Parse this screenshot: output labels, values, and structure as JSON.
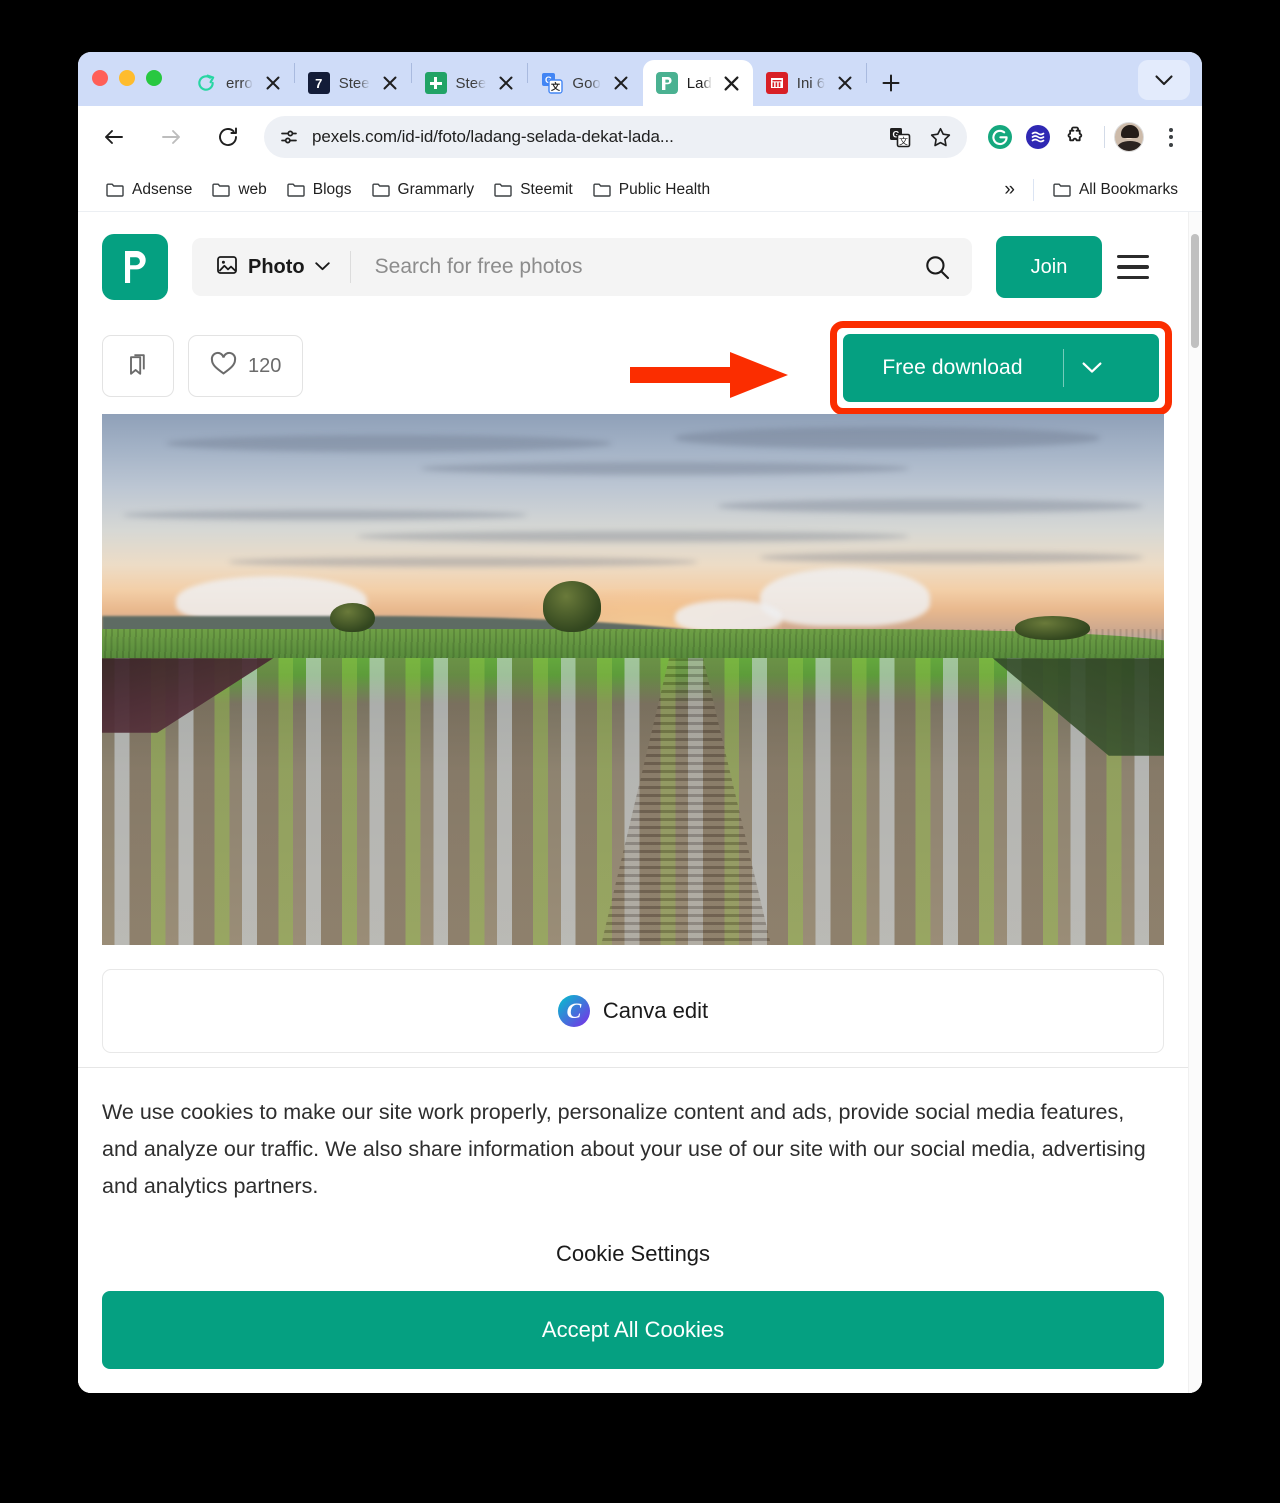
{
  "browser": {
    "tabs": [
      {
        "title": "erro",
        "favicon": "error-spiral-icon",
        "active": false
      },
      {
        "title": "Stee",
        "favicon": "seven-icon",
        "active": false
      },
      {
        "title": "Stee",
        "favicon": "sheets-icon",
        "active": false
      },
      {
        "title": "Goo",
        "favicon": "google-translate-icon",
        "active": false
      },
      {
        "title": "Lad",
        "favicon": "pexels-icon",
        "active": true
      },
      {
        "title": "Ini 6",
        "favicon": "ini-icon",
        "active": false
      }
    ],
    "new_tab_label": "+",
    "tab_list_chevron": "chevron-down-icon",
    "omnibox": {
      "url": "pexels.com/id-id/foto/ladang-selada-dekat-lada...",
      "site_info_icon": "tune-icon",
      "translate_icon": "translate-icon",
      "bookmark_icon": "star-icon"
    },
    "toolbar_extensions": [
      "grammarly-icon",
      "steem-icon",
      "extensions-puzzle-icon"
    ],
    "profile": "profile-avatar",
    "menu": "three-dots-menu-icon",
    "bookmarks": [
      {
        "label": "Adsense"
      },
      {
        "label": "web"
      },
      {
        "label": "Blogs"
      },
      {
        "label": "Grammarly"
      },
      {
        "label": "Steemit"
      },
      {
        "label": "Public Health"
      }
    ],
    "bookmarks_overflow": "»",
    "all_bookmarks_label": "All Bookmarks"
  },
  "pexels": {
    "logo": "pexels-logo",
    "search": {
      "type_label": "Photo",
      "type_icon": "image-icon",
      "chevron": "chevron-down-icon",
      "placeholder": "Search for free photos",
      "search_icon": "search-icon"
    },
    "join_label": "Join",
    "menu_icon": "hamburger-menu-icon",
    "actions": {
      "bookmark_icon": "collection-bookmark-icon",
      "like_icon": "heart-icon",
      "like_count": "120",
      "download_label": "Free download",
      "download_caret": "chevron-down-icon"
    },
    "annotation": {
      "arrow": "red-arrow-right",
      "highlight_color": "#fb2d00"
    },
    "photo": {
      "alt": "Lettuce field near cornfield at sunset"
    },
    "canva": {
      "logo": "canva-logo",
      "label": "Canva edit"
    },
    "cookie": {
      "text": "We use cookies to make our site work properly, personalize content and ads, provide social media features, and analyze our traffic. We also share information about your use of our site with our social media, advertising and analytics partners.",
      "settings_label": "Cookie Settings",
      "accept_label": "Accept All Cookies"
    }
  },
  "colors": {
    "pexels_green": "#05a081",
    "annotation_red": "#fb2d00",
    "tab_strip": "#cfdcf8"
  }
}
